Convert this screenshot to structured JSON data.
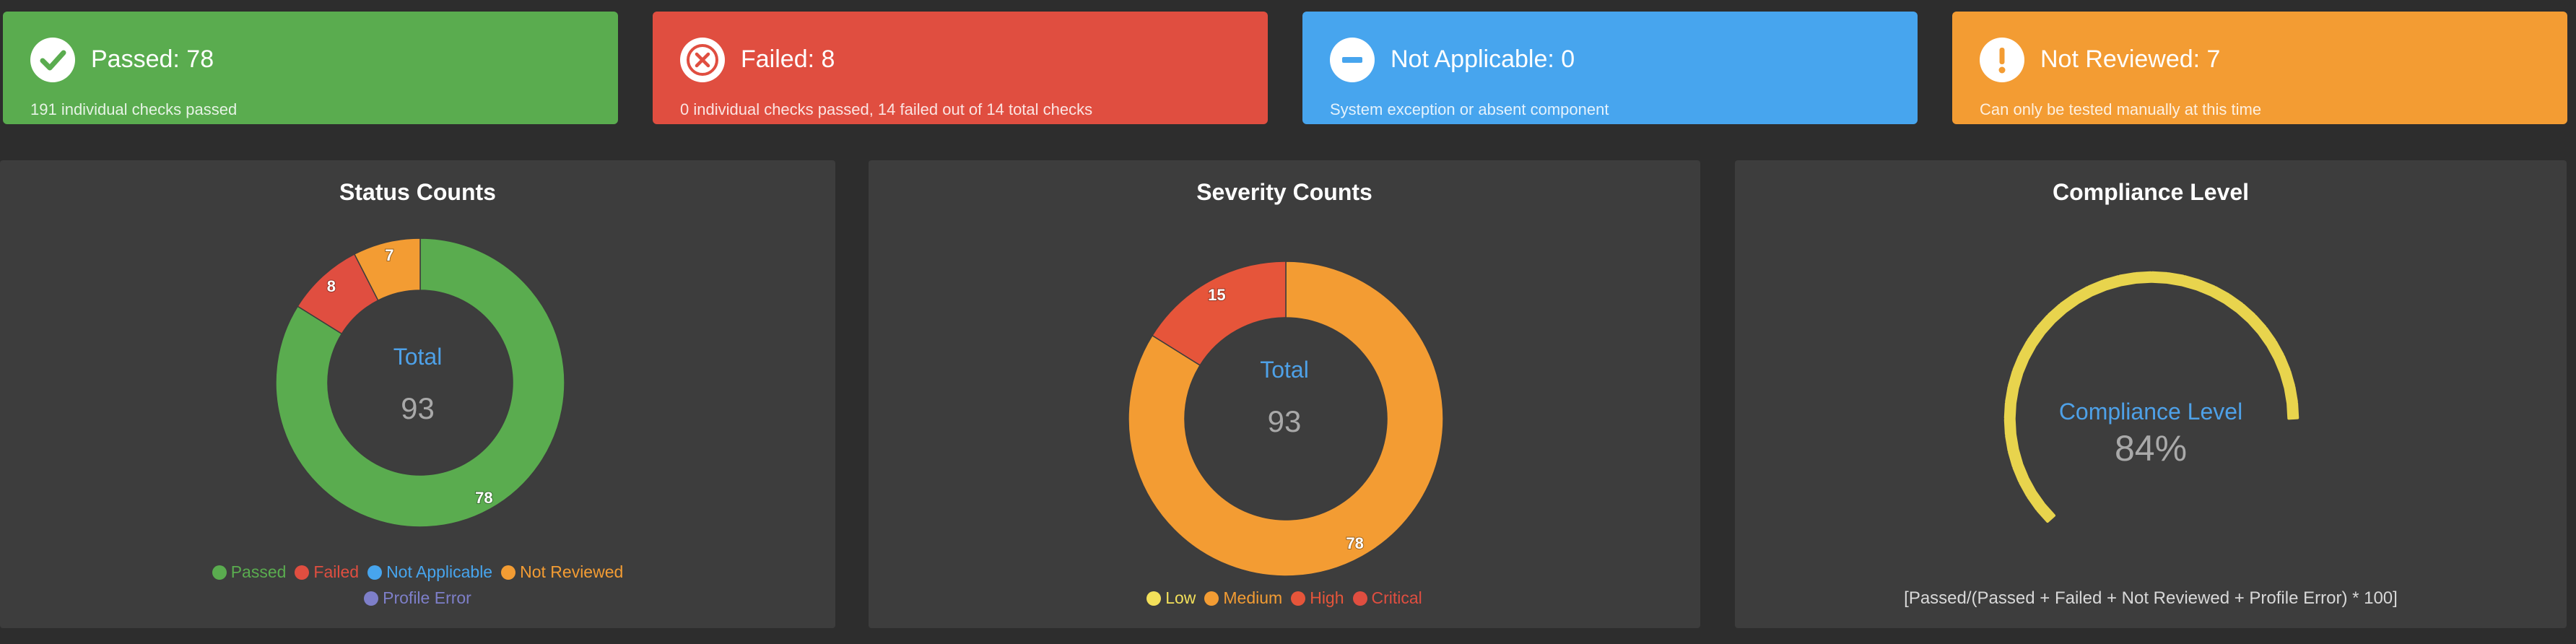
{
  "summary_cards": [
    {
      "title": "Passed: 78",
      "subtitle": "191 individual checks passed",
      "color": "#5aac4f",
      "icon": "check-icon"
    },
    {
      "title": "Failed: 8",
      "subtitle": "0 individual checks passed, 14 failed out of 14 total checks",
      "color": "#e04e40",
      "icon": "x-icon"
    },
    {
      "title": "Not Applicable: 0",
      "subtitle": "System exception or absent component",
      "color": "#47a5ee",
      "icon": "minus-icon"
    },
    {
      "title": "Not Reviewed: 7",
      "subtitle": "Can only be tested manually at this time",
      "color": "#f39c33",
      "icon": "exclamation-icon"
    }
  ],
  "status_panel": {
    "title": "Status Counts",
    "center_label": "Total",
    "center_value": "93",
    "legend": [
      {
        "label": "Passed",
        "color": "#5aac4f"
      },
      {
        "label": "Failed",
        "color": "#e04e40"
      },
      {
        "label": "Not Applicable",
        "color": "#47a5ee"
      },
      {
        "label": "Not Reviewed",
        "color": "#f39c33"
      },
      {
        "label": "Profile Error",
        "color": "#7e7fc9"
      }
    ]
  },
  "severity_panel": {
    "title": "Severity Counts",
    "center_label": "Total",
    "center_value": "93",
    "legend": [
      {
        "label": "Low",
        "color": "#f3e05a"
      },
      {
        "label": "Medium",
        "color": "#f39c33"
      },
      {
        "label": "High",
        "color": "#e6553a"
      },
      {
        "label": "Critical",
        "color": "#e04e40"
      }
    ]
  },
  "compliance_panel": {
    "title": "Compliance Level",
    "gauge_label": "Compliance Level",
    "gauge_value": "84%",
    "formula": "[Passed/(Passed + Failed + Not Reviewed + Profile Error) * 100]",
    "gauge_color": "#e8d44d"
  },
  "chart_data": [
    {
      "type": "pie",
      "title": "Status Counts",
      "categories": [
        "Passed",
        "Failed",
        "Not Applicable",
        "Not Reviewed",
        "Profile Error"
      ],
      "values": [
        78,
        8,
        0,
        7,
        0
      ],
      "data_labels": [
        "78",
        "8",
        "",
        "7",
        ""
      ],
      "colors": [
        "#5aac4f",
        "#e04e40",
        "#47a5ee",
        "#f39c33",
        "#7e7fc9"
      ],
      "legend": "bottom"
    },
    {
      "type": "pie",
      "title": "Severity Counts",
      "categories": [
        "Low",
        "Medium",
        "High",
        "Critical"
      ],
      "values": [
        0,
        78,
        15,
        0
      ],
      "data_labels": [
        "",
        "78",
        "15",
        ""
      ],
      "colors": [
        "#f3e05a",
        "#f39c33",
        "#e6553a",
        "#e04e40"
      ],
      "legend": "bottom"
    },
    {
      "type": "gauge",
      "title": "Compliance Level",
      "value": 84,
      "range": [
        0,
        100
      ],
      "unit": "%"
    }
  ]
}
